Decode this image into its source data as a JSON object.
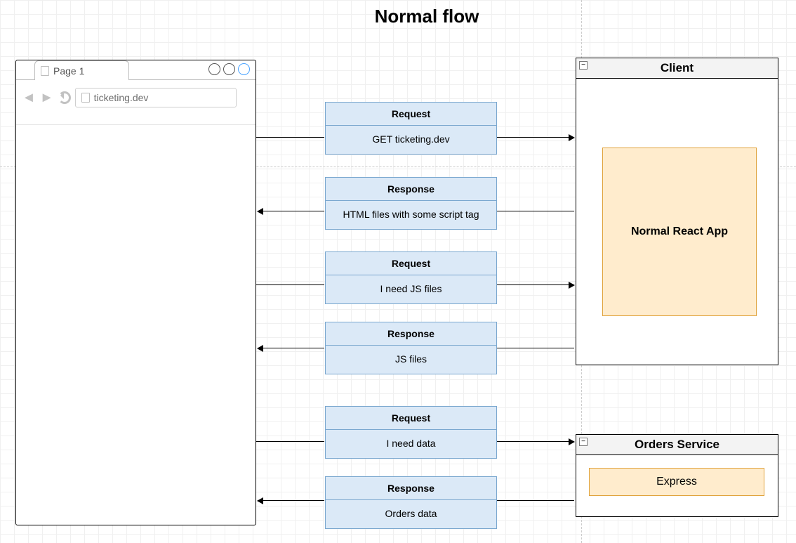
{
  "title": "Normal flow",
  "browser": {
    "tab_label": "Page 1",
    "url": "ticketing.dev"
  },
  "messages": [
    {
      "kind": "Request",
      "body": "GET ticketing.dev"
    },
    {
      "kind": "Response",
      "body": "HTML files with some script tag"
    },
    {
      "kind": "Request",
      "body": "I need JS files"
    },
    {
      "kind": "Response",
      "body": "JS files"
    },
    {
      "kind": "Request",
      "body": "I need data"
    },
    {
      "kind": "Response",
      "body": "Orders data"
    }
  ],
  "client_panel": {
    "title": "Client",
    "inner": "Normal React App"
  },
  "orders_panel": {
    "title": "Orders Service",
    "inner": "Express"
  },
  "icons": {
    "back": "◄",
    "fwd": "►",
    "collapse": "−"
  }
}
